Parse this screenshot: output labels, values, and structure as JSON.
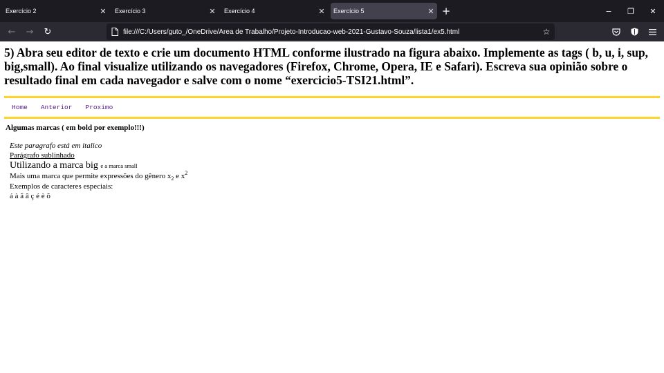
{
  "browser": {
    "tabs": [
      {
        "title": "Exercício 2",
        "active": false
      },
      {
        "title": "Exercício 3",
        "active": false
      },
      {
        "title": "Exercício 4",
        "active": false
      },
      {
        "title": "Exercício 5",
        "active": true
      }
    ],
    "new_tab_icon": "plus-icon",
    "window_controls": {
      "minimize": "−",
      "restore": "❐",
      "close": "✕"
    },
    "tab_close_glyph": "✕",
    "nav": {
      "back": "←",
      "forward": "→",
      "reload": "↻"
    },
    "url": "file:///C:/Users/guto_/OneDrive/Área de Trabalho/Projeto-Introducao-web-2021-Gustavo-Souza/lista1/ex5.html",
    "bookmark_glyph": "☆",
    "toolbar_icons": [
      "pocket-icon",
      "shield-icon",
      "menu-icon"
    ],
    "colors": {
      "tabbar": "#1c1b22",
      "active_tab": "#42414d",
      "navbar": "#2b2a33"
    }
  },
  "page": {
    "heading": "5) Abra seu editor de texto e crie um documento HTML conforme ilustrado na figura abaixo. Implemente as tags ( b, u, i, sup, big,small). Ao final visualize utilizando os navegadores (Firefox, Chrome, Opera, IE e Safari). Escreva sua opinião sobre o resultado final em cada navegador e salve com o nome “exercicio5-TSI21.html”.",
    "menu": [
      "Home",
      "Anterior",
      "Proximo"
    ],
    "section_heading": "Algumas marcas ( em bold por exemplo!!!)",
    "italic_line": "Este paragrafo está em italico",
    "underline_line": "Parágrafo sublinhado",
    "big_text": "Utilizando a marca big",
    "small_text": "e a marca small",
    "expr_prefix": "Mais uma marca que permite expressões do gênero x",
    "expr_sub": "2",
    "expr_mid": " e x",
    "expr_sup": "2",
    "special_label": "Exemplos de caracteres especiais:",
    "special_chars": "á à ã â ç é è õ",
    "accent_color": "#ffd42a",
    "link_color": "#551a8b"
  }
}
